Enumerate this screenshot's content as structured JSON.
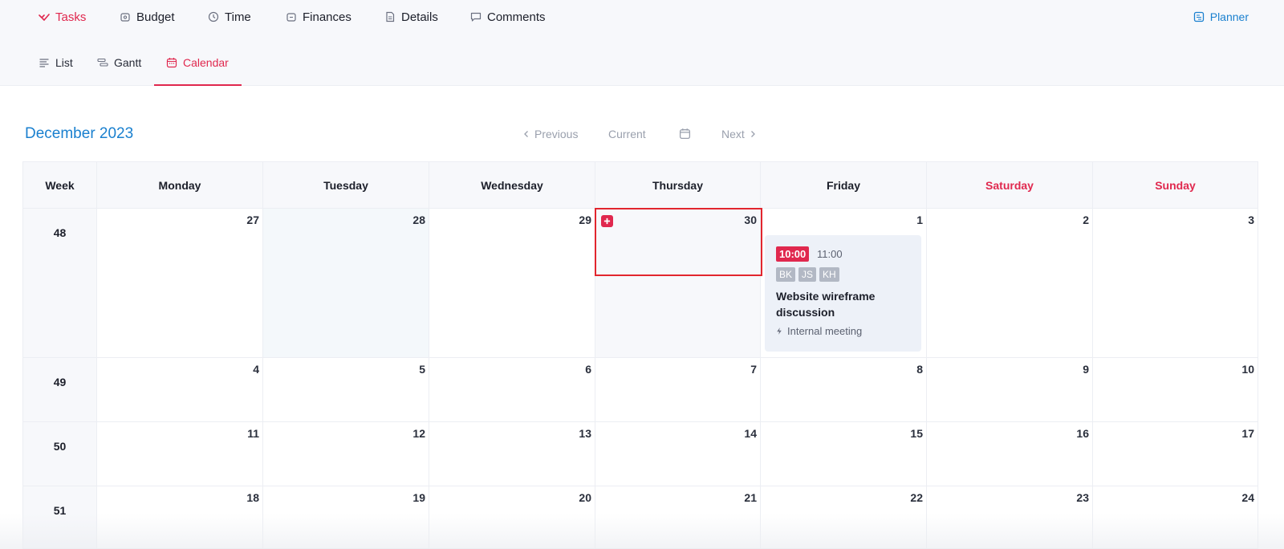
{
  "topnav": {
    "tasks": "Tasks",
    "budget": "Budget",
    "time": "Time",
    "finances": "Finances",
    "details": "Details",
    "comments": "Comments",
    "planner": "Planner"
  },
  "subnav": {
    "list": "List",
    "gantt": "Gantt",
    "calendar": "Calendar"
  },
  "calendar": {
    "month_title": "December 2023",
    "previous": "Previous",
    "current": "Current",
    "next": "Next",
    "headers": [
      "Week",
      "Monday",
      "Tuesday",
      "Wednesday",
      "Thursday",
      "Friday",
      "Saturday",
      "Sunday"
    ],
    "weeks": [
      {
        "week": "48",
        "days": [
          "27",
          "28",
          "29",
          "30",
          "1",
          "2",
          "3"
        ]
      },
      {
        "week": "49",
        "days": [
          "4",
          "5",
          "6",
          "7",
          "8",
          "9",
          "10"
        ]
      },
      {
        "week": "50",
        "days": [
          "11",
          "12",
          "13",
          "14",
          "15",
          "16",
          "17"
        ]
      },
      {
        "week": "51",
        "days": [
          "18",
          "19",
          "20",
          "21",
          "22",
          "23",
          "24"
        ]
      }
    ]
  },
  "event": {
    "start": "10:00",
    "end": "11:00",
    "attendees": [
      "BK",
      "JS",
      "KH"
    ],
    "title": "Website wireframe discussion",
    "type": "Internal meeting"
  },
  "colors": {
    "accent": "#e0284e",
    "link": "#1a80cf",
    "selection": "#e2262e"
  }
}
